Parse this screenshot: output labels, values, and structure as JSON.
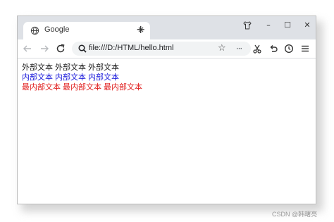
{
  "browser": {
    "tab_title": "Google",
    "tab_close_glyph": "×",
    "new_tab_glyph": "+",
    "url": "file:///D:/HTML/hello.html",
    "window_controls": {
      "minimize": "–",
      "maximize": "☐",
      "close": "✕"
    },
    "icons": [
      "globe-icon",
      "back-arrow-icon",
      "forward-arrow-icon",
      "reload-icon",
      "search-icon",
      "star-icon",
      "more-icon",
      "scissors-icon",
      "undo-icon",
      "history-icon",
      "menu-icon",
      "shirt-icon"
    ]
  },
  "page": {
    "outer_texts": [
      "外部文本",
      "外部文本",
      "外部文本"
    ],
    "inner_texts": [
      "内部文本",
      "内部文本",
      "内部文本"
    ],
    "innermost_texts": [
      "最内部文本",
      "最内部文本",
      "最内部文本"
    ],
    "colors": {
      "outer": "#222222",
      "inner": "#1a1adb",
      "innermost": "#e01e1e"
    }
  },
  "watermark": "CSDN @韩曙亮"
}
